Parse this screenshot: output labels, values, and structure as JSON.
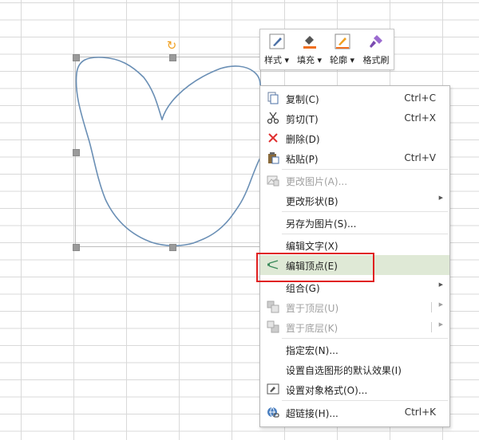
{
  "toolbar": {
    "items": [
      {
        "label": "样式",
        "icon": "pen-style-icon"
      },
      {
        "label": "填充",
        "icon": "paint-bucket-icon"
      },
      {
        "label": "轮廓",
        "icon": "outline-pencil-icon"
      },
      {
        "label": "格式刷",
        "icon": "format-brush-icon"
      }
    ]
  },
  "menu": {
    "items": [
      {
        "label": "复制(C)",
        "shortcut": "Ctrl+C",
        "icon": "copy-icon"
      },
      {
        "label": "剪切(T)",
        "shortcut": "Ctrl+X",
        "icon": "scissors-icon"
      },
      {
        "label": "删除(D)",
        "icon": "delete-x-icon"
      },
      {
        "label": "粘贴(P)",
        "shortcut": "Ctrl+V",
        "icon": "paste-icon"
      },
      {
        "label": "更改图片(A)...",
        "icon": "picture-icon",
        "disabled": true
      },
      {
        "label": "更改形状(B)",
        "submenu": true
      },
      {
        "label": "另存为图片(S)..."
      },
      {
        "label": "编辑文字(X)"
      },
      {
        "label": "编辑顶点(E)",
        "icon": "edit-points-icon",
        "highlighted": true
      },
      {
        "label": "组合(G)",
        "submenu": true
      },
      {
        "label": "置于顶层(U)",
        "icon": "bring-front-icon",
        "submenu": true,
        "disabled": true
      },
      {
        "label": "置于底层(K)",
        "icon": "send-back-icon",
        "submenu": true,
        "disabled": true
      },
      {
        "label": "指定宏(N)..."
      },
      {
        "label": "设置自选图形的默认效果(I)"
      },
      {
        "label": "设置对象格式(O)...",
        "icon": "format-object-icon"
      },
      {
        "label": "超链接(H)...",
        "shortcut": "Ctrl+K",
        "icon": "hyperlink-icon"
      }
    ]
  },
  "colors": {
    "highlight": "#dfe9d6",
    "annotation_box": "#e02020",
    "shape_stroke": "#6a8fb5",
    "rotate_handle": "#f0a020"
  }
}
